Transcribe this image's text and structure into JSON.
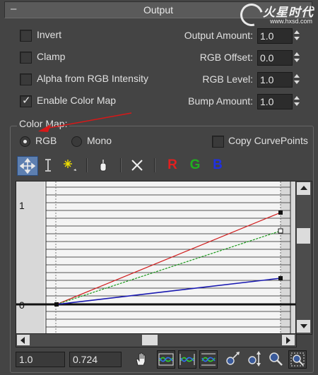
{
  "rollout": {
    "collapse_glyph": "–",
    "title": "Output"
  },
  "watermark": {
    "brand": "火星时代",
    "url": "www.hxsd.com"
  },
  "options": {
    "invert": {
      "label": "Invert",
      "checked": false
    },
    "clamp": {
      "label": "Clamp",
      "checked": false
    },
    "alpha_from_rgb": {
      "label": "Alpha from RGB Intensity",
      "checked": false
    },
    "enable_color_map": {
      "label": "Enable Color Map",
      "checked": true
    }
  },
  "spinners": {
    "output_amount": {
      "label": "Output Amount:",
      "value": "1.0"
    },
    "rgb_offset": {
      "label": "RGB Offset:",
      "value": "0.0"
    },
    "rgb_level": {
      "label": "RGB Level:",
      "value": "1.0"
    },
    "bump_amount": {
      "label": "Bump Amount:",
      "value": "1.0"
    }
  },
  "color_map": {
    "group_title": "Color Map:",
    "mode_rgb": {
      "label": "RGB",
      "selected": true
    },
    "mode_mono": {
      "label": "Mono",
      "selected": false
    },
    "copy_curvepoints": {
      "label": "Copy CurvePoints",
      "checked": false
    }
  },
  "toolbar": {
    "move_icon": "move-icon",
    "scale_point_icon": "scale-point-icon",
    "add_point_icon": "add-point-icon",
    "reset_icon": "reset-curves-icon",
    "delete_icon": "delete-point-icon",
    "channel_r": "R",
    "channel_g": "G",
    "channel_b": "B",
    "colors": {
      "r": "#e02020",
      "g": "#20b020",
      "b": "#2030e0"
    }
  },
  "graph": {
    "y_label_top": "1",
    "y_label_bottom": "0",
    "curves": {
      "red": {
        "color": "#d01818"
      },
      "green": {
        "color": "#1a9a1a"
      },
      "blue": {
        "color": "#1818b0"
      }
    }
  },
  "status": {
    "x_value": "1.0",
    "y_value": "0.724"
  },
  "bottom_tools": [
    "pan-icon",
    "zoom-extents-icon",
    "zoom-horizontal-extents-icon",
    "zoom-vertical-extents-icon",
    "zoom-horizontal-icon",
    "zoom-vertical-icon",
    "zoom-icon",
    "zoom-region-icon"
  ],
  "annotation": {
    "color": "#d81818"
  }
}
